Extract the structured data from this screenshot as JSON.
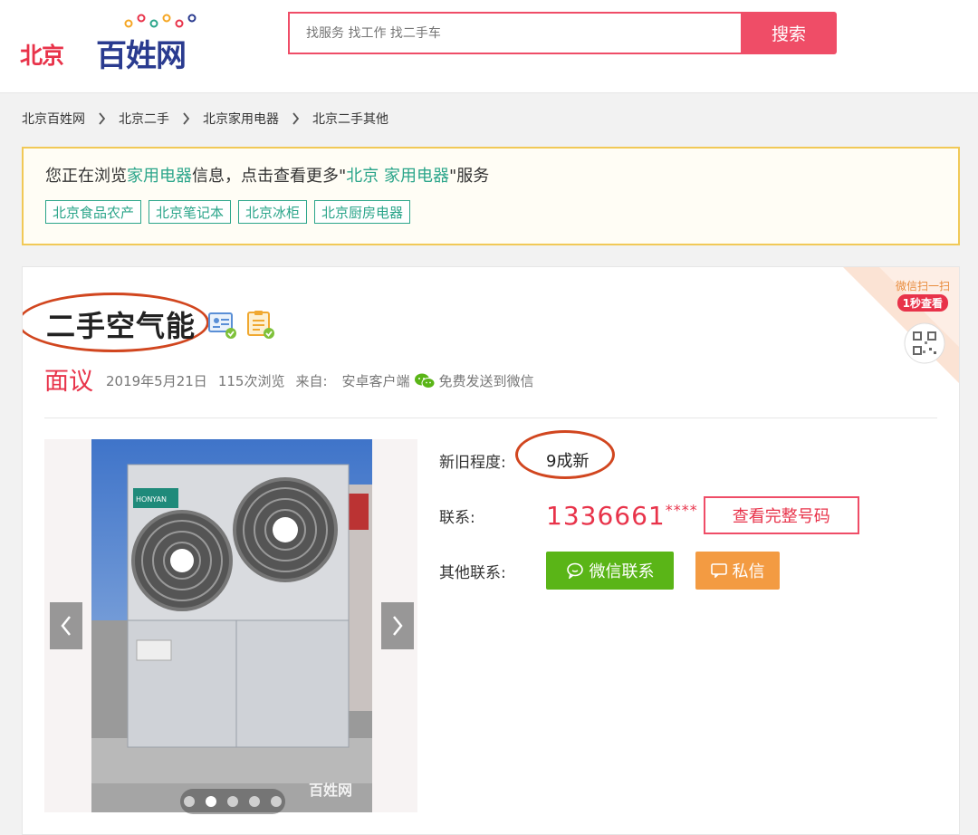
{
  "header": {
    "logo_city": "北京",
    "logo_brand": "百姓网",
    "search_placeholder": "找服务 找工作 找二手车",
    "search_button": "搜索"
  },
  "breadcrumb": [
    "北京百姓网",
    "北京二手",
    "北京家用电器",
    "北京二手其他"
  ],
  "notice": {
    "prefix": "您正在浏览",
    "category": "家用电器",
    "middle": "信息，点击查看更多\"",
    "link": "北京 家用电器",
    "suffix": "\"服务",
    "tags": [
      "北京食品农产",
      "北京笔记本",
      "北京冰柜",
      "北京厨房电器"
    ]
  },
  "listing": {
    "title": "二手空气能",
    "price": "面议",
    "date": "2019年5月21日",
    "views": "115次浏览",
    "source_label": "来自:",
    "source": "安卓客户端",
    "send_wechat": "免费发送到微信",
    "condition_label": "新旧程度:",
    "condition_value": "9成新",
    "contact_label": "联系:",
    "phone": "1336661",
    "phone_mask": "****",
    "full_number_button": "查看完整号码",
    "other_contact_label": "其他联系:",
    "wechat_button": "微信联系",
    "message_button": "私信",
    "photo_watermark": "百姓网",
    "photo_unit_brand": "HONYAN",
    "gallery_total": 5,
    "gallery_active": 2
  },
  "corner": {
    "line1": "微信扫一扫",
    "line2": "1秒查看"
  },
  "colors": {
    "brand_red": "#e8334a",
    "brand_blue": "#2a3b8f",
    "teal": "#2ba58a",
    "wechat_green": "#5ab517",
    "orange": "#f39b42",
    "annotation": "#d1461f"
  }
}
